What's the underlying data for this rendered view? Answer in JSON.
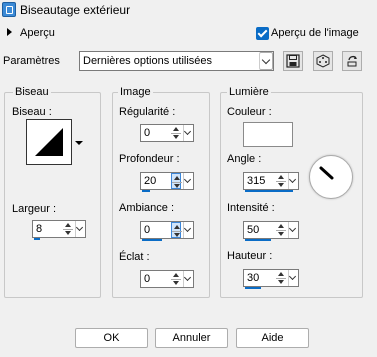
{
  "window": {
    "title": "Biseautage extérieur"
  },
  "preview": {
    "section_label": "Aperçu",
    "checkbox_label": "Aperçu de l'image",
    "checked": true
  },
  "params": {
    "label": "Paramètres",
    "preset": "Dernières options utilisées"
  },
  "bevel": {
    "title": "Biseau",
    "bevel_label": "Biseau :",
    "width_label": "Largeur :",
    "width_value": "8"
  },
  "image": {
    "title": "Image",
    "smoothness_label": "Régularité :",
    "smoothness_value": "0",
    "depth_label": "Profondeur :",
    "depth_value": "20",
    "ambience_label": "Ambiance :",
    "ambience_value": "0",
    "shine_label": "Éclat :",
    "shine_value": "0"
  },
  "light": {
    "title": "Lumière",
    "color_label": "Couleur :",
    "color": "#ffffff",
    "angle_label": "Angle :",
    "angle_value": "315",
    "intensity_label": "Intensité :",
    "intensity_value": "50",
    "elevation_label": "Hauteur :",
    "elevation_value": "30"
  },
  "buttons": {
    "ok": "OK",
    "cancel": "Annuler",
    "help": "Aide"
  },
  "colors": {
    "accent": "#0a6cc6"
  }
}
